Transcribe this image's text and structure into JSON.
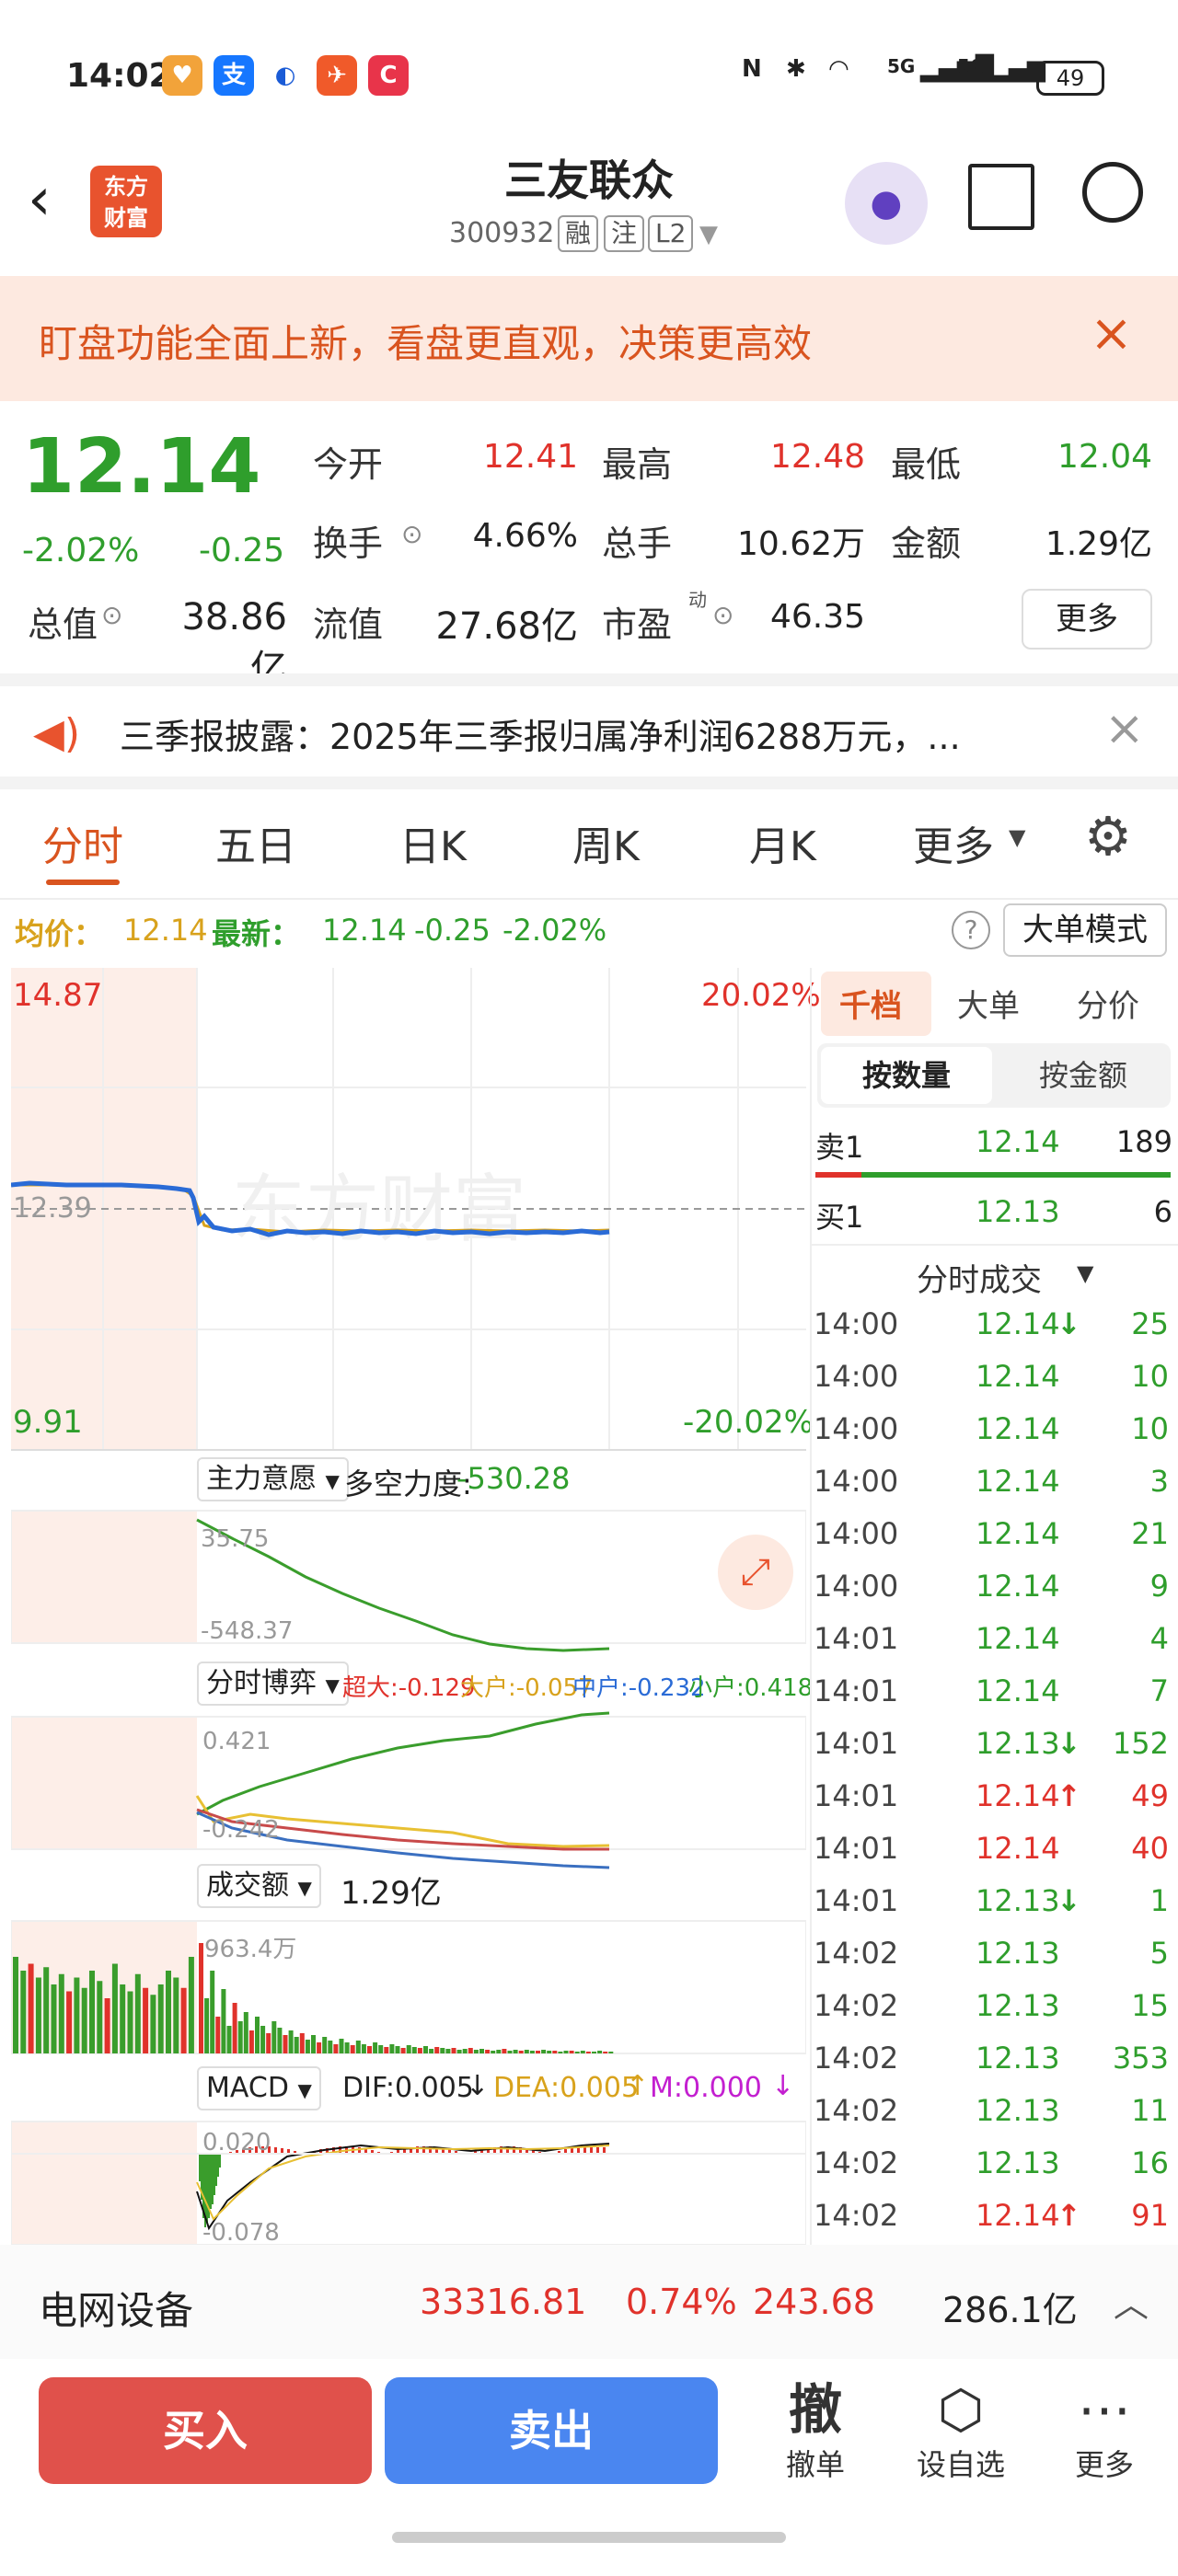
{
  "status": {
    "time": "14:02",
    "battery": "49",
    "network1": "5G",
    "network2": "5G"
  },
  "header": {
    "title": "三友联众",
    "code": "300932",
    "tags": [
      "融",
      "注",
      "L2"
    ],
    "logo_line1": "东方",
    "logo_line2": "财富"
  },
  "banner": {
    "text": "盯盘功能全面上新，看盘更直观，决策更高效"
  },
  "quote": {
    "price": "12.14",
    "pct": "-2.02%",
    "chg": "-0.25",
    "open_label": "今开",
    "open": "12.41",
    "high_label": "最高",
    "high": "12.48",
    "low_label": "最低",
    "low": "12.04",
    "turnover_label": "换手",
    "turnover": "4.66%",
    "volume_label": "总手",
    "volume": "10.62万",
    "amount_label": "金额",
    "amount": "1.29亿",
    "mktcap_label": "总值",
    "mktcap": "38.86亿",
    "float_label": "流值",
    "float": "27.68亿",
    "pe_label": "市盈",
    "pe_sup": "动",
    "pe": "46.35",
    "more": "更多"
  },
  "notice": {
    "text": "三季报披露：2025年三季报归属净利润6288万元，..."
  },
  "tabs": [
    "分时",
    "五日",
    "日K",
    "周K",
    "月K",
    "更多"
  ],
  "legend": {
    "avg_label": "均价：",
    "avg": "12.14",
    "latest_label": "最新：",
    "latest": "12.14",
    "chg": "-0.25",
    "pct": "-2.02%",
    "mode": "大单模式"
  },
  "chart": {
    "top_price": "14.87",
    "top_pct": "20.02%",
    "mid_price": "12.39",
    "bot_price": "9.91",
    "bot_pct": "-20.02%",
    "ind1_label": "主力意愿",
    "ind1_name": "多空力度:",
    "ind1_value": "-530.28",
    "ind1_max": "35.75",
    "ind1_min": "-548.37",
    "ind2_label": "分时博弈",
    "ind2_super": "超大:-0.129",
    "ind2_big": "大户:-0.057",
    "ind2_mid": "中户:-0.232",
    "ind2_small": "小户:0.418",
    "ind2_max": "0.421",
    "ind2_min": "-0.242",
    "ind3_label": "成交额",
    "ind3_value": "1.29亿",
    "ind3_max": "963.4万",
    "ind4_label": "MACD",
    "ind4_dif": "DIF:0.005",
    "ind4_dea": "DEA:0.005",
    "ind4_m": "M:0.000",
    "ind4_max": "0.020",
    "ind4_min": "-0.078",
    "watermark": "东方财富"
  },
  "orderbook": {
    "tabs": [
      "千档",
      "大单",
      "分价"
    ],
    "subtabs": [
      "按数量",
      "按金额"
    ],
    "sell_label": "卖1",
    "sell_price": "12.14",
    "sell_qty": "189",
    "buy_label": "买1",
    "buy_price": "12.13",
    "buy_qty": "6",
    "trades_title": "分时成交",
    "trades": [
      {
        "t": "14:00",
        "p": "12.14",
        "d": "↓",
        "q": "25",
        "c": "green"
      },
      {
        "t": "14:00",
        "p": "12.14",
        "d": "",
        "q": "10",
        "c": "green"
      },
      {
        "t": "14:00",
        "p": "12.14",
        "d": "",
        "q": "10",
        "c": "green"
      },
      {
        "t": "14:00",
        "p": "12.14",
        "d": "",
        "q": "3",
        "c": "green"
      },
      {
        "t": "14:00",
        "p": "12.14",
        "d": "",
        "q": "21",
        "c": "green"
      },
      {
        "t": "14:00",
        "p": "12.14",
        "d": "",
        "q": "9",
        "c": "green"
      },
      {
        "t": "14:01",
        "p": "12.14",
        "d": "",
        "q": "4",
        "c": "green"
      },
      {
        "t": "14:01",
        "p": "12.14",
        "d": "",
        "q": "7",
        "c": "green"
      },
      {
        "t": "14:01",
        "p": "12.13",
        "d": "↓",
        "q": "152",
        "c": "green"
      },
      {
        "t": "14:01",
        "p": "12.14",
        "d": "↑",
        "q": "49",
        "c": "red"
      },
      {
        "t": "14:01",
        "p": "12.14",
        "d": "",
        "q": "40",
        "c": "red"
      },
      {
        "t": "14:01",
        "p": "12.13",
        "d": "↓",
        "q": "1",
        "c": "green"
      },
      {
        "t": "14:02",
        "p": "12.13",
        "d": "",
        "q": "5",
        "c": "green"
      },
      {
        "t": "14:02",
        "p": "12.13",
        "d": "",
        "q": "15",
        "c": "green"
      },
      {
        "t": "14:02",
        "p": "12.13",
        "d": "",
        "q": "353",
        "c": "green"
      },
      {
        "t": "14:02",
        "p": "12.13",
        "d": "",
        "q": "11",
        "c": "green"
      },
      {
        "t": "14:02",
        "p": "12.13",
        "d": "",
        "q": "16",
        "c": "green"
      },
      {
        "t": "14:02",
        "p": "12.14",
        "d": "↑",
        "q": "91",
        "c": "red"
      }
    ]
  },
  "sector": {
    "name": "电网设备",
    "index": "33316.81",
    "pct": "0.74%",
    "chg": "243.68",
    "amount": "286.1亿"
  },
  "actions": {
    "buy": "买入",
    "sell": "卖出",
    "cancel_icon": "撤",
    "cancel": "撤单",
    "watch": "设自选",
    "more": "更多"
  },
  "colors": {
    "up": "#e0322b",
    "down": "#2f9e2c",
    "accent": "#d9541f",
    "buy": "#e0514b",
    "sell": "#4a86f0"
  }
}
